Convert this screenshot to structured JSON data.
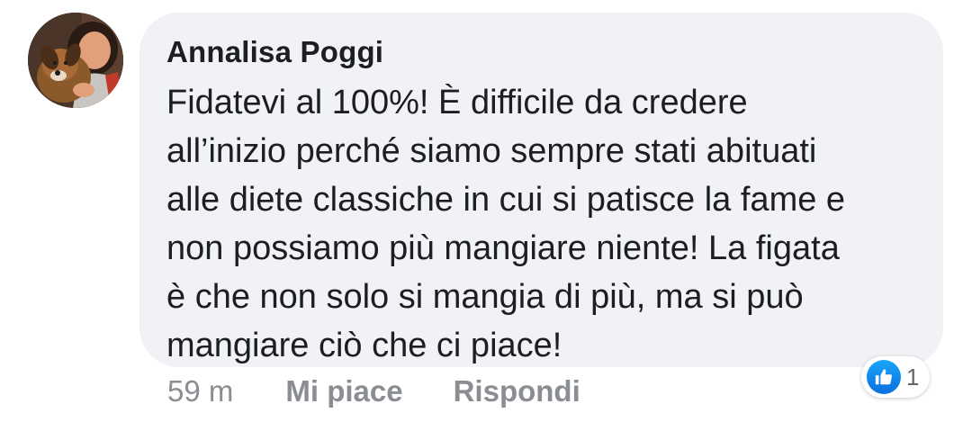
{
  "comment": {
    "author": "Annalisa Poggi",
    "text_lines": [
      "Fidatevi al 100%! È difficile da credere",
      "all’inizio perché siamo sempre stati abituati",
      "alle diete classiche in cui si patisce la fame e",
      "non possiamo più mangiare niente! La figata",
      "è che non solo si mangia di più, ma si può",
      "mangiare ciò che ci piace!"
    ],
    "avatar_icon": "profile-photo"
  },
  "actions": {
    "timestamp": "59 m",
    "like_label": "Mi piace",
    "reply_label": "Rispondi"
  },
  "reactions": {
    "icon": "like-icon",
    "count": "1"
  },
  "colors": {
    "bubble": "#f0f2f5",
    "text": "#1c1e21",
    "muted": "#8a8d91",
    "like_blue": "#0b6fe0"
  }
}
